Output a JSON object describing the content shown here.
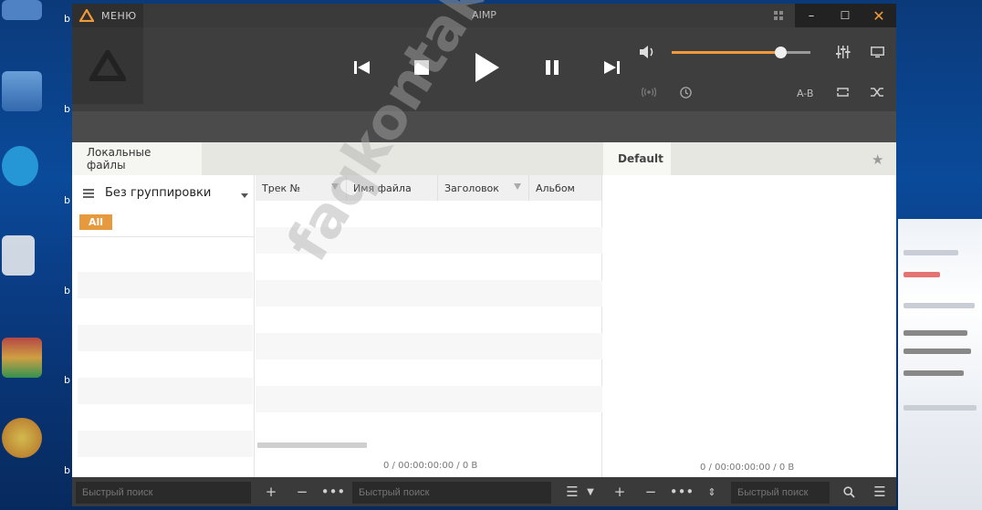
{
  "window": {
    "app_title": "AIMP",
    "menu_label": "МЕНЮ",
    "minimize": "–",
    "maximize": "☐",
    "close": "✕"
  },
  "player": {
    "volume_percent": 78,
    "ab_label": "A-B"
  },
  "tabs": {
    "library_tab": "Локальные файлы",
    "playlist_tab": "Default"
  },
  "library": {
    "grouping_label": "Без группировки",
    "all_badge": "All",
    "columns": [
      "Трек №",
      "Имя файла",
      "Заголовок",
      "Альбом"
    ],
    "status": "0 / 00:00:00:00 / 0 B"
  },
  "playlist": {
    "status": "0 / 00:00:00:00 / 0 B"
  },
  "bottom": {
    "search1_placeholder": "Быстрый поиск",
    "search2_placeholder": "Быстрый поиск",
    "search3_placeholder": "Быстрый поиск"
  },
  "desktop": {
    "icon_label": "b"
  },
  "watermark": "faqkontakt.ru",
  "colors": {
    "accent": "#f29a3a",
    "titlebar": "#3a3a3a",
    "player": "#3e3e3e"
  }
}
